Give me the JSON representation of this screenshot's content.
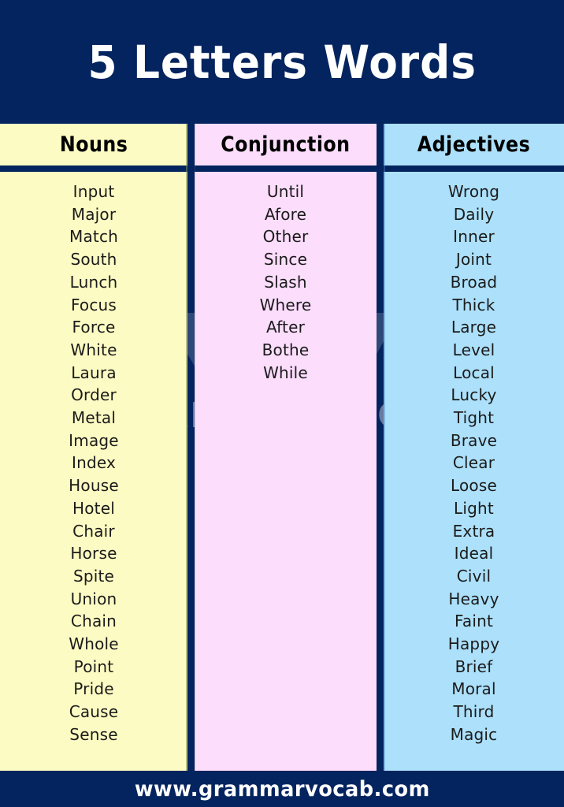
{
  "title": "5 Letters Words",
  "footer": {
    "website": "www.grammarvocab.com"
  },
  "watermark": {
    "text": "GRAMMARVOCAB",
    "logo": "v-chevron-logo"
  },
  "colors": {
    "header_band": "#04245f",
    "nouns_bg": "#fcfbc3",
    "conjunction_bg": "#fcddfc",
    "adjectives_bg": "#ace0fb",
    "title_text": "#ffffff",
    "word_text": "#1b1b1b",
    "column_header_text": "#000000"
  },
  "columns": [
    {
      "key": "nouns",
      "header": "Nouns",
      "words": [
        "Input",
        "Major",
        "Match",
        "South",
        "Lunch",
        "Focus",
        "Force",
        "White",
        "Laura",
        "Order",
        "Metal",
        "Image",
        "Index",
        "House",
        "Hotel",
        "Chair",
        "Horse",
        "Spite",
        "Union",
        "Chain",
        "Whole",
        "Point",
        "Pride",
        "Cause",
        "Sense"
      ]
    },
    {
      "key": "conjunction",
      "header": "Conjunction",
      "words": [
        "Until",
        "Afore",
        "Other",
        "Since",
        "Slash",
        "Where",
        "After",
        "Bothe",
        "While"
      ]
    },
    {
      "key": "adjectives",
      "header": "Adjectives",
      "words": [
        "Wrong",
        "Daily",
        "Inner",
        "Joint",
        "Broad",
        "Thick",
        "Large",
        "Level",
        "Local",
        "Lucky",
        "Tight",
        "Brave",
        "Clear",
        "Loose",
        "Light",
        "Extra",
        "Ideal",
        "Civil",
        "Heavy",
        "Faint",
        "Happy",
        "Brief",
        "Moral",
        "Third",
        "Magic"
      ]
    }
  ]
}
